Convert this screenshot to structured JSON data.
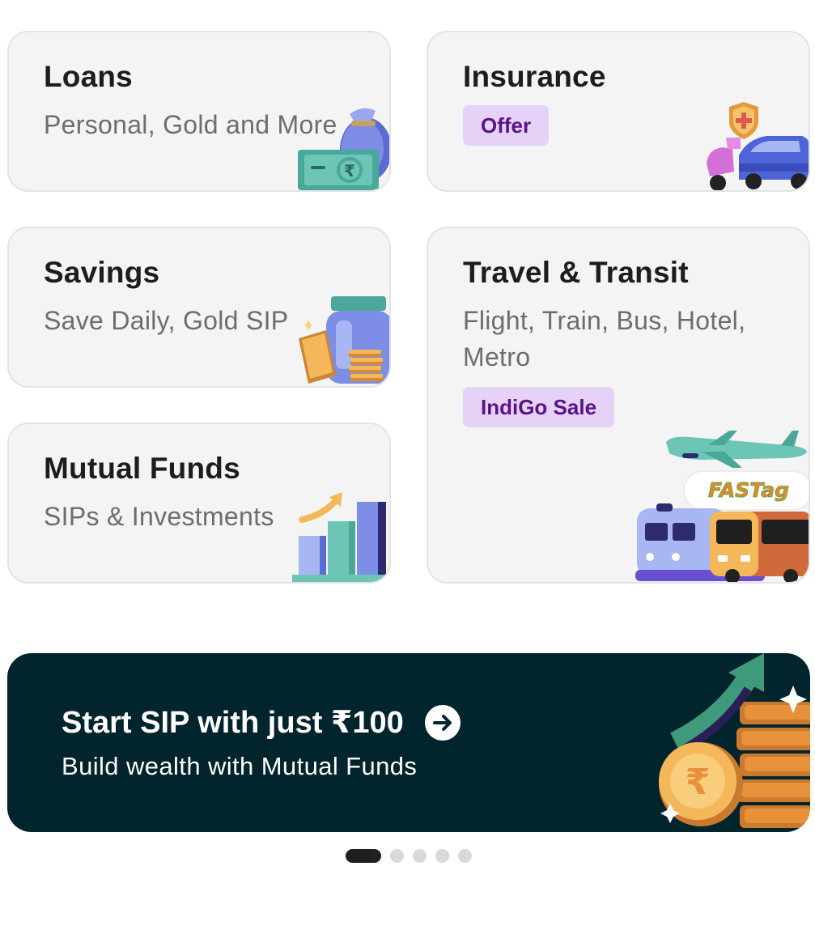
{
  "cards": {
    "loans": {
      "title": "Loans",
      "subtitle": "Personal, Gold and More",
      "icon": "money-bag-icon"
    },
    "insurance": {
      "title": "Insurance",
      "badge": "Offer",
      "icon": "vehicle-insurance-icon"
    },
    "savings": {
      "title": "Savings",
      "subtitle": "Save Daily, Gold SIP",
      "icon": "savings-jar-icon"
    },
    "travel": {
      "title": "Travel & Transit",
      "subtitle": "Flight, Train, Bus, Hotel, Metro",
      "badge": "IndiGo Sale",
      "fastag_logo": "FASTag",
      "icon": "travel-icon"
    },
    "mutual_funds": {
      "title": "Mutual Funds",
      "subtitle": "SIPs & Investments",
      "icon": "growth-chart-icon"
    }
  },
  "banner": {
    "title": "Start SIP with just ₹100",
    "subtitle": "Build wealth with Mutual Funds",
    "arrow_icon": "arrow-right-icon",
    "illustration": "coins-growth-icon"
  },
  "carousel": {
    "total": 5,
    "active_index": 0
  },
  "colors": {
    "badge_bg": "#e7d2f7",
    "badge_text": "#5a1289",
    "banner_bg": "#02242c",
    "card_bg": "#f4f4f4"
  }
}
